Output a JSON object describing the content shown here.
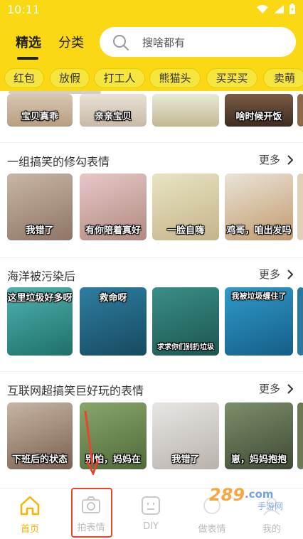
{
  "status": {
    "time": "10:11"
  },
  "tabs": [
    {
      "label": "精选",
      "active": true
    },
    {
      "label": "分类",
      "active": false
    }
  ],
  "search": {
    "placeholder": "搜啥都有"
  },
  "chips": [
    "红包",
    "放假",
    "打工人",
    "熊猫头",
    "买买买",
    "卖萌"
  ],
  "top_row": {
    "captions": [
      "宝贝真乖",
      "亲亲宝贝",
      "",
      "啥时候开饭"
    ]
  },
  "sections": [
    {
      "title": "一组搞笑的修勾表情",
      "more": "更多",
      "items": [
        "我错了",
        "有你陪着真好",
        "一脸自嗨",
        "鸡哥，咱出发吗"
      ]
    },
    {
      "title": "海洋被污染后",
      "more": "更多",
      "items": [
        "这里垃圾好多呀",
        "救命呀",
        "求求你们别扔垃圾",
        "我被垃圾缠住了"
      ]
    },
    {
      "title": "互联网超搞笑巨好玩的表情",
      "more": "更多",
      "items": [
        "下班后的状态",
        "别怕，妈妈在",
        "我错了",
        "崽，妈妈抱抱"
      ]
    }
  ],
  "bottom_nav": [
    {
      "label": "首页",
      "icon": "home-icon",
      "active": true
    },
    {
      "label": "拍表情",
      "icon": "camera-icon",
      "active": false
    },
    {
      "label": "DIY",
      "icon": "diy-face-icon",
      "active": false
    },
    {
      "label": "做表情",
      "icon": "make-sticker-icon",
      "active": false
    },
    {
      "label": "我的",
      "icon": "profile-icon",
      "active": false
    }
  ],
  "watermark": {
    "text": "289.com",
    "sub": "手游网"
  },
  "colors": {
    "brand_yellow": "#fbd814",
    "active_nav": "#f7b500",
    "highlight": "#e8452c"
  }
}
